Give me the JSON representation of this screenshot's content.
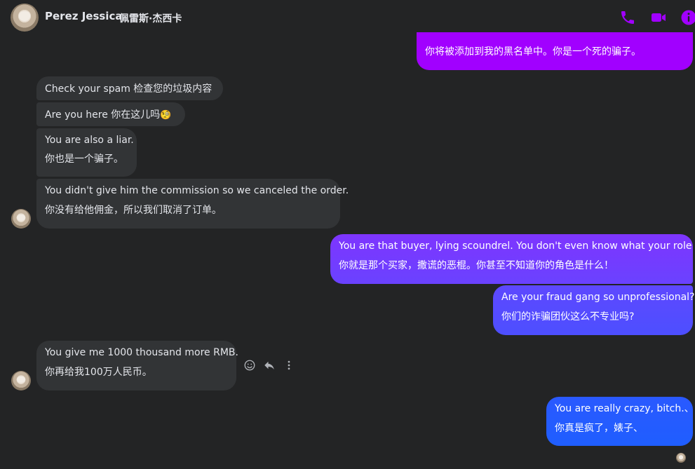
{
  "header": {
    "name": "Perez Jessica",
    "name_cn": "佩雷斯·杰西卡",
    "icons": [
      "phone-icon",
      "video-icon",
      "info-icon"
    ],
    "accent": "#a100ff"
  },
  "messages": {
    "m0": {
      "lines": [
        "你将被添加到我的黑名单中。你是一个死的骗子。"
      ],
      "direction": "outgoing"
    },
    "m1": {
      "lines": [
        "Check your spam  检查您的垃圾内容"
      ],
      "direction": "incoming"
    },
    "m2": {
      "lines": [
        "Are you here  你在这儿吗"
      ],
      "emoji": "🧐",
      "direction": "incoming"
    },
    "m3": {
      "lines": [
        "You are also a liar.",
        "你也是一个骗子。"
      ],
      "direction": "incoming"
    },
    "m4": {
      "lines": [
        "You didn't give him the commission so we canceled the order.",
        "你没有给他佣金，所以我们取消了订单。"
      ],
      "direction": "incoming"
    },
    "m5": {
      "lines": [
        "You are that buyer, lying scoundrel. You don't even know what your role is!",
        "你就是那个买家，撒谎的恶棍。你甚至不知道你的角色是什么！"
      ],
      "direction": "outgoing"
    },
    "m6": {
      "lines": [
        "Are your fraud gang so unprofessional?",
        "你们的诈骗团伙这么不专业吗?"
      ],
      "direction": "outgoing"
    },
    "m7": {
      "lines": [
        "You give me 1000 thousand more RMB.",
        "你再给我100万人民币。"
      ],
      "direction": "incoming"
    },
    "m8": {
      "lines": [
        "You are really crazy, bitch.、",
        "你真是疯了，婊子、"
      ],
      "direction": "outgoing"
    }
  },
  "message_actions": [
    "react-icon",
    "reply-icon",
    "more-icon"
  ],
  "colors": {
    "background": "#232425",
    "incoming_bubble": "#323436",
    "outgoing_gradient": [
      "#a100ff",
      "#7a3cff",
      "#5b4bff",
      "#1f5eff"
    ]
  }
}
